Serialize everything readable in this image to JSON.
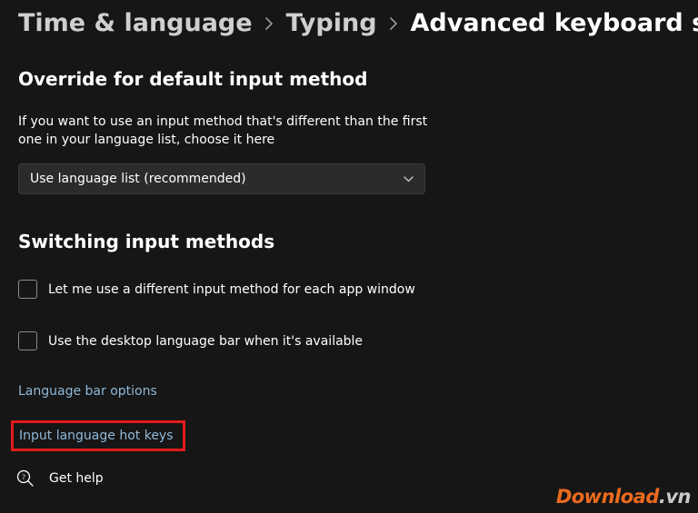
{
  "breadcrumb": {
    "level1": "Time & language",
    "level2": "Typing",
    "level3": "Advanced keyboard settings"
  },
  "section1": {
    "title": "Override for default input method",
    "desc": "If you want to use an input method that's different than the first one in your language list, choose it here",
    "dropdown_value": "Use language list (recommended)"
  },
  "section2": {
    "title": "Switching input methods",
    "check1_label": "Let me use a different input method for each app window",
    "check2_label": "Use the desktop language bar when it's available"
  },
  "links": {
    "lang_bar_options": "Language bar options",
    "hot_keys": "Input language hot keys"
  },
  "help": {
    "label": "Get help"
  },
  "watermark": {
    "brand": "Download",
    "tld": ".vn"
  }
}
